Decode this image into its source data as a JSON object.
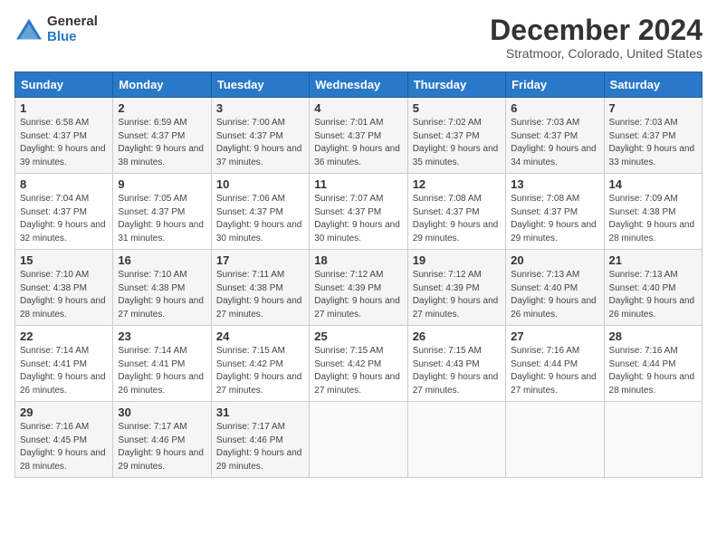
{
  "logo": {
    "general": "General",
    "blue": "Blue"
  },
  "title": "December 2024",
  "location": "Stratmoor, Colorado, United States",
  "days_of_week": [
    "Sunday",
    "Monday",
    "Tuesday",
    "Wednesday",
    "Thursday",
    "Friday",
    "Saturday"
  ],
  "weeks": [
    [
      {
        "num": "1",
        "rise": "6:58 AM",
        "set": "4:37 PM",
        "daylight": "9 hours and 39 minutes."
      },
      {
        "num": "2",
        "rise": "6:59 AM",
        "set": "4:37 PM",
        "daylight": "9 hours and 38 minutes."
      },
      {
        "num": "3",
        "rise": "7:00 AM",
        "set": "4:37 PM",
        "daylight": "9 hours and 37 minutes."
      },
      {
        "num": "4",
        "rise": "7:01 AM",
        "set": "4:37 PM",
        "daylight": "9 hours and 36 minutes."
      },
      {
        "num": "5",
        "rise": "7:02 AM",
        "set": "4:37 PM",
        "daylight": "9 hours and 35 minutes."
      },
      {
        "num": "6",
        "rise": "7:03 AM",
        "set": "4:37 PM",
        "daylight": "9 hours and 34 minutes."
      },
      {
        "num": "7",
        "rise": "7:03 AM",
        "set": "4:37 PM",
        "daylight": "9 hours and 33 minutes."
      }
    ],
    [
      {
        "num": "8",
        "rise": "7:04 AM",
        "set": "4:37 PM",
        "daylight": "9 hours and 32 minutes."
      },
      {
        "num": "9",
        "rise": "7:05 AM",
        "set": "4:37 PM",
        "daylight": "9 hours and 31 minutes."
      },
      {
        "num": "10",
        "rise": "7:06 AM",
        "set": "4:37 PM",
        "daylight": "9 hours and 30 minutes."
      },
      {
        "num": "11",
        "rise": "7:07 AM",
        "set": "4:37 PM",
        "daylight": "9 hours and 30 minutes."
      },
      {
        "num": "12",
        "rise": "7:08 AM",
        "set": "4:37 PM",
        "daylight": "9 hours and 29 minutes."
      },
      {
        "num": "13",
        "rise": "7:08 AM",
        "set": "4:37 PM",
        "daylight": "9 hours and 29 minutes."
      },
      {
        "num": "14",
        "rise": "7:09 AM",
        "set": "4:38 PM",
        "daylight": "9 hours and 28 minutes."
      }
    ],
    [
      {
        "num": "15",
        "rise": "7:10 AM",
        "set": "4:38 PM",
        "daylight": "9 hours and 28 minutes."
      },
      {
        "num": "16",
        "rise": "7:10 AM",
        "set": "4:38 PM",
        "daylight": "9 hours and 27 minutes."
      },
      {
        "num": "17",
        "rise": "7:11 AM",
        "set": "4:38 PM",
        "daylight": "9 hours and 27 minutes."
      },
      {
        "num": "18",
        "rise": "7:12 AM",
        "set": "4:39 PM",
        "daylight": "9 hours and 27 minutes."
      },
      {
        "num": "19",
        "rise": "7:12 AM",
        "set": "4:39 PM",
        "daylight": "9 hours and 27 minutes."
      },
      {
        "num": "20",
        "rise": "7:13 AM",
        "set": "4:40 PM",
        "daylight": "9 hours and 26 minutes."
      },
      {
        "num": "21",
        "rise": "7:13 AM",
        "set": "4:40 PM",
        "daylight": "9 hours and 26 minutes."
      }
    ],
    [
      {
        "num": "22",
        "rise": "7:14 AM",
        "set": "4:41 PM",
        "daylight": "9 hours and 26 minutes."
      },
      {
        "num": "23",
        "rise": "7:14 AM",
        "set": "4:41 PM",
        "daylight": "9 hours and 26 minutes."
      },
      {
        "num": "24",
        "rise": "7:15 AM",
        "set": "4:42 PM",
        "daylight": "9 hours and 27 minutes."
      },
      {
        "num": "25",
        "rise": "7:15 AM",
        "set": "4:42 PM",
        "daylight": "9 hours and 27 minutes."
      },
      {
        "num": "26",
        "rise": "7:15 AM",
        "set": "4:43 PM",
        "daylight": "9 hours and 27 minutes."
      },
      {
        "num": "27",
        "rise": "7:16 AM",
        "set": "4:44 PM",
        "daylight": "9 hours and 27 minutes."
      },
      {
        "num": "28",
        "rise": "7:16 AM",
        "set": "4:44 PM",
        "daylight": "9 hours and 28 minutes."
      }
    ],
    [
      {
        "num": "29",
        "rise": "7:16 AM",
        "set": "4:45 PM",
        "daylight": "9 hours and 28 minutes."
      },
      {
        "num": "30",
        "rise": "7:17 AM",
        "set": "4:46 PM",
        "daylight": "9 hours and 29 minutes."
      },
      {
        "num": "31",
        "rise": "7:17 AM",
        "set": "4:46 PM",
        "daylight": "9 hours and 29 minutes."
      },
      null,
      null,
      null,
      null
    ]
  ]
}
